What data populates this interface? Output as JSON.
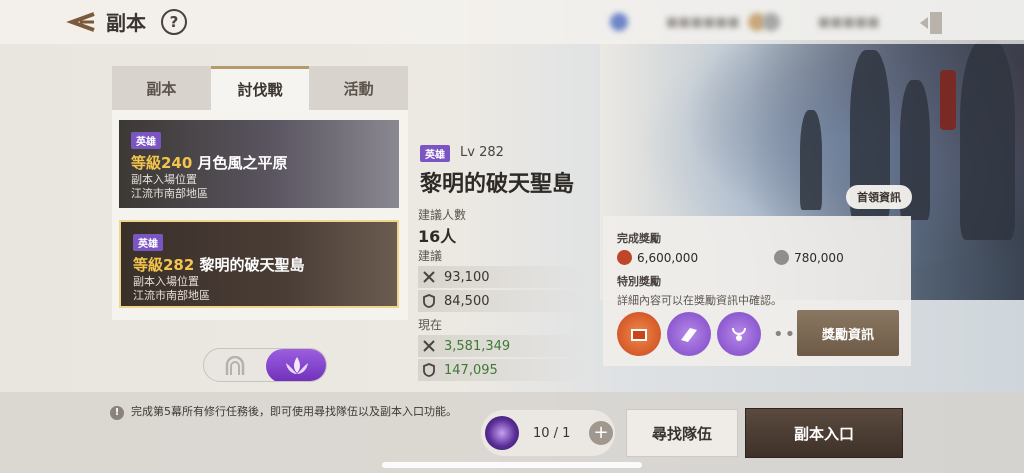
{
  "header": {
    "title": "副本",
    "help": "?"
  },
  "tabs": [
    {
      "label": "副本",
      "active": false
    },
    {
      "label": "討伐戰",
      "active": true
    },
    {
      "label": "活動",
      "active": false
    }
  ],
  "dungeon_list": [
    {
      "badge": "英雄",
      "level": "等級240",
      "name": "月色風之平原",
      "entry_label": "副本入場位置",
      "location": "江流市南部地區",
      "selected": false
    },
    {
      "badge": "英雄",
      "level": "等級282",
      "name": "黎明的破天聖島",
      "entry_label": "副本入場位置",
      "location": "江流市南部地區",
      "selected": true
    }
  ],
  "detail": {
    "badge": "英雄",
    "level": "Lv 282",
    "name": "黎明的破天聖島",
    "recommended_people_label": "建議人數",
    "recommended_people": "16人",
    "recommended_label": "建議",
    "recommended_attack": "93,100",
    "recommended_defense": "84,500",
    "current_label": "現在",
    "current_attack": "3,581,349",
    "current_defense": "147,095",
    "boss_info_button": "首領資訊"
  },
  "rewards": {
    "complete_label": "完成獎勵",
    "gold": "6,600,000",
    "silver": "780,000",
    "special_label": "特別獎勵",
    "special_desc": "詳細內容可以在獎勵資訊中確認。",
    "more": "•••",
    "info_button": "獎勵資訊"
  },
  "footer": {
    "notice": "完成第5幕所有修行任務後，即可使用尋找隊伍以及副本入口功能。",
    "ticket_count": "10 / 1",
    "plus": "+",
    "find_party_button": "尋找隊伍",
    "enter_button": "副本入口"
  },
  "colors": {
    "accent_purple": "#7b56c2",
    "level_gold": "#f3c54d",
    "current_green": "#3e7a33"
  }
}
